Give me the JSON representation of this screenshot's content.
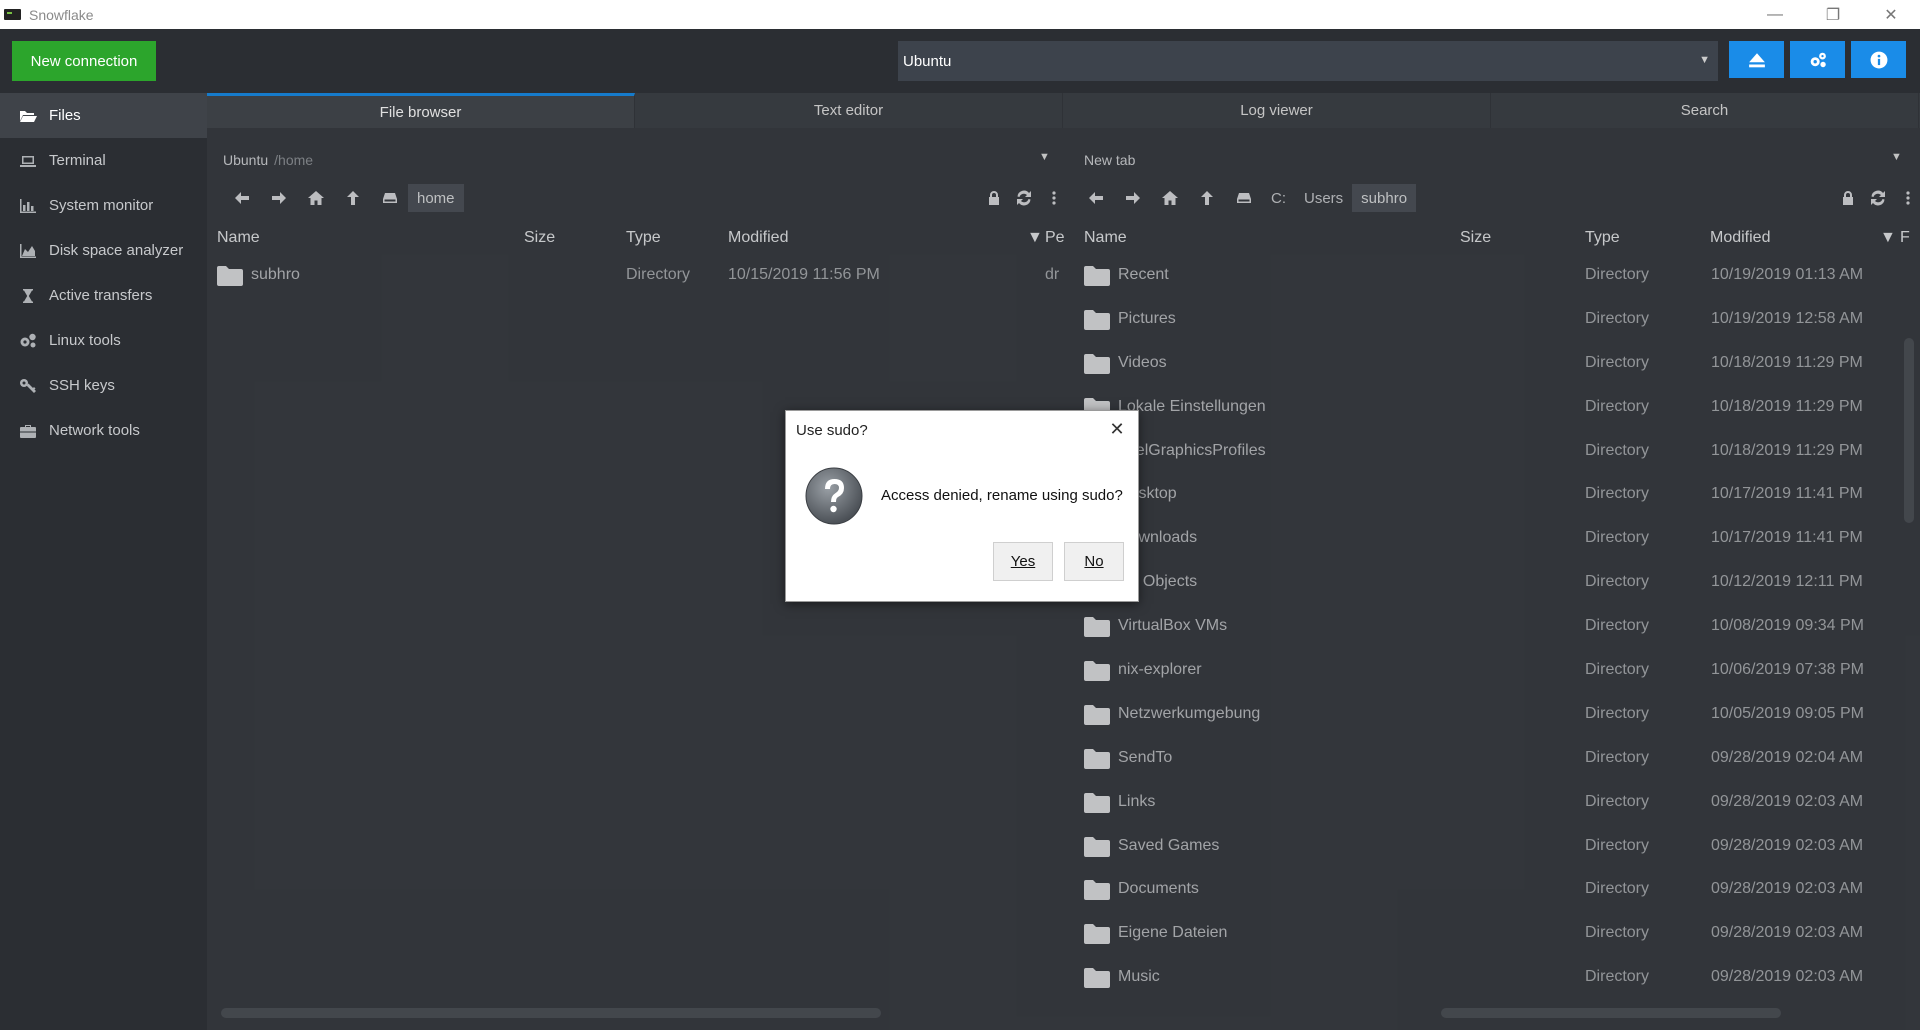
{
  "window": {
    "title": "Snowflake",
    "controls": [
      "—",
      "❐",
      "✕"
    ]
  },
  "toolbar": {
    "new_connection_label": "New connection",
    "session": "Ubuntu",
    "colors": {
      "accent": "#1a8ce8",
      "new_connection": "#2ca52c"
    }
  },
  "sidebar": {
    "items": [
      {
        "label": "Files",
        "icon": "folder-open-icon",
        "active": true
      },
      {
        "label": "Terminal",
        "icon": "laptop-icon"
      },
      {
        "label": "System monitor",
        "icon": "bar-chart-icon"
      },
      {
        "label": "Disk space analyzer",
        "icon": "area-chart-icon"
      },
      {
        "label": "Active transfers",
        "icon": "hourglass-icon"
      },
      {
        "label": "Linux tools",
        "icon": "gears-icon"
      },
      {
        "label": "SSH keys",
        "icon": "key-icon"
      },
      {
        "label": "Network tools",
        "icon": "briefcase-icon"
      }
    ]
  },
  "tabs": [
    "File browser",
    "Text editor",
    "Log viewer",
    "Search"
  ],
  "left_pane": {
    "address_host": "Ubuntu",
    "address_path": "/home",
    "crumbs": [
      "home"
    ],
    "columns": [
      "Name",
      "Size",
      "Type",
      "Modified",
      "Pe"
    ],
    "rows": [
      {
        "name": "subhro",
        "size": "",
        "type": "Directory",
        "modified": "10/15/2019 11:56 PM",
        "perm": "dr"
      }
    ]
  },
  "right_pane": {
    "address": "New tab",
    "crumbs": [
      "C:",
      "Users",
      "subhro"
    ],
    "columns": [
      "Name",
      "Size",
      "Type",
      "Modified",
      "F"
    ],
    "rows": [
      {
        "name": "Recent",
        "type": "Directory",
        "modified": "10/19/2019 01:13 AM"
      },
      {
        "name": "Pictures",
        "type": "Directory",
        "modified": "10/19/2019 12:58 AM"
      },
      {
        "name": "Videos",
        "type": "Directory",
        "modified": "10/18/2019 11:29 PM"
      },
      {
        "name": "Lokale Einstellungen",
        "type": "Directory",
        "modified": "10/18/2019 11:29 PM"
      },
      {
        "name": "IntelGraphicsProfiles",
        "type": "Directory",
        "modified": "10/18/2019 11:29 PM"
      },
      {
        "name": "Desktop",
        "type": "Directory",
        "modified": "10/17/2019 11:41 PM"
      },
      {
        "name": "Downloads",
        "type": "Directory",
        "modified": "10/17/2019 11:41 PM"
      },
      {
        "name": "3D Objects",
        "type": "Directory",
        "modified": "10/12/2019 12:11 PM"
      },
      {
        "name": "VirtualBox VMs",
        "type": "Directory",
        "modified": "10/08/2019 09:34 PM"
      },
      {
        "name": "nix-explorer",
        "type": "Directory",
        "modified": "10/06/2019 07:38 PM"
      },
      {
        "name": "Netzwerkumgebung",
        "type": "Directory",
        "modified": "10/05/2019 09:05 PM"
      },
      {
        "name": "SendTo",
        "type": "Directory",
        "modified": "09/28/2019 02:04 AM"
      },
      {
        "name": "Links",
        "type": "Directory",
        "modified": "09/28/2019 02:03 AM"
      },
      {
        "name": "Saved Games",
        "type": "Directory",
        "modified": "09/28/2019 02:03 AM"
      },
      {
        "name": "Documents",
        "type": "Directory",
        "modified": "09/28/2019 02:03 AM"
      },
      {
        "name": "Eigene Dateien",
        "type": "Directory",
        "modified": "09/28/2019 02:03 AM"
      },
      {
        "name": "Music",
        "type": "Directory",
        "modified": "09/28/2019 02:03 AM"
      }
    ]
  },
  "dialog": {
    "title": "Use sudo?",
    "message": "Access denied, rename using sudo?",
    "yes_label": "Yes",
    "no_label": "No",
    "icon": "question-icon"
  }
}
